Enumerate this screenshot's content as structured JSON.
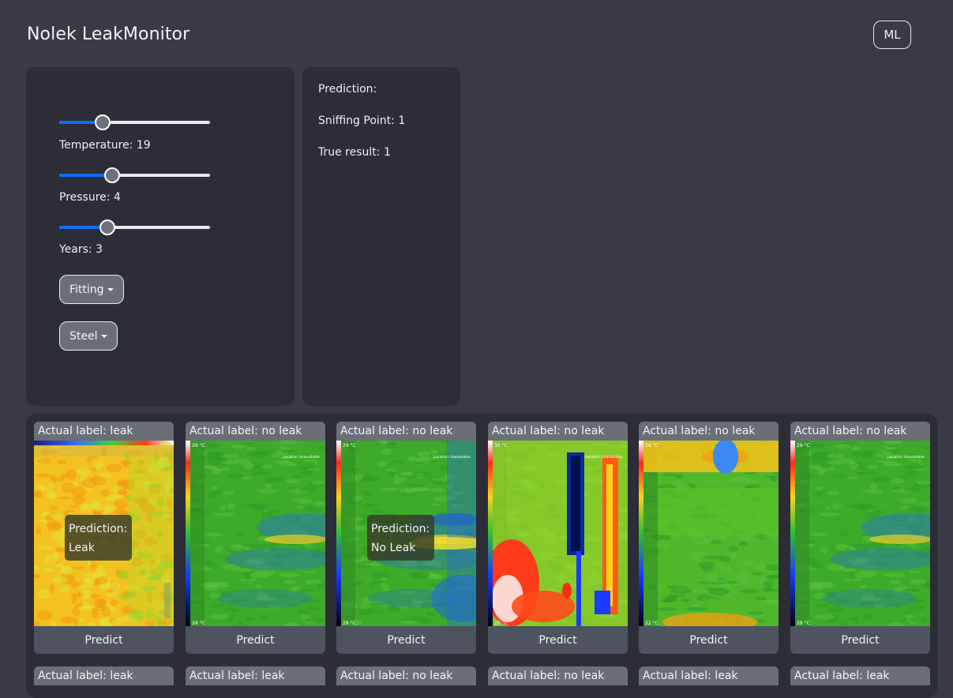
{
  "app": {
    "title": "Nolek LeakMonitor",
    "ml_button_label": "ML"
  },
  "controls": {
    "sliders": [
      {
        "name": "temperature",
        "label": "Temperature: 19",
        "value": 19,
        "fraction": 0.29
      },
      {
        "name": "pressure",
        "label": "Pressure: 4",
        "value": 4,
        "fraction": 0.35
      },
      {
        "name": "years",
        "label": "Years: 3",
        "value": 3,
        "fraction": 0.32
      }
    ],
    "dropdowns": [
      {
        "name": "fitting",
        "label": "Fitting"
      },
      {
        "name": "material",
        "label": "Steel"
      }
    ]
  },
  "result": {
    "prediction": "Prediction:",
    "sniffing_point": "Sniffing Point: 1",
    "true_result": "True result: 1"
  },
  "gallery": {
    "predict_label": "Predict",
    "prediction_heading": "Prediction:",
    "cards": [
      {
        "actual_label": "Actual label: leak",
        "prediction": "Leak",
        "scheme": "hot",
        "scale_top": "",
        "scale_bottom": ""
      },
      {
        "actual_label": "Actual label: no leak",
        "prediction": "",
        "scheme": "green",
        "scale_top": "29 °C",
        "scale_bottom": "28 °C"
      },
      {
        "actual_label": "Actual label: no leak",
        "prediction": "No Leak",
        "scheme": "green-blue",
        "scale_top": "29 °C",
        "scale_bottom": "28 °C"
      },
      {
        "actual_label": "Actual label: no leak",
        "prediction": "",
        "scheme": "pipe",
        "scale_top": "35 °C",
        "scale_bottom": "20 °C"
      },
      {
        "actual_label": "Actual label: no leak",
        "prediction": "",
        "scheme": "spot",
        "scale_top": "26 °C",
        "scale_bottom": "22 °C"
      },
      {
        "actual_label": "Actual label: no leak",
        "prediction": "",
        "scheme": "green",
        "scale_top": "29 °C",
        "scale_bottom": "28 °C"
      }
    ],
    "next_row_labels": [
      "Actual label: leak",
      "Actual label: leak",
      "Actual label: no leak",
      "Actual label: no leak",
      "Actual label: leak",
      "Actual label: leak"
    ],
    "image_overlay_text": "Location Unavailable"
  }
}
